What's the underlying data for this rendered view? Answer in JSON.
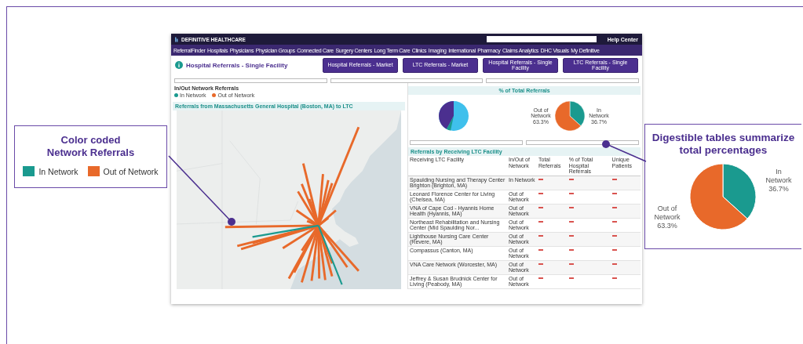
{
  "left_callout": {
    "title": "Color coded Network Referrals",
    "legend": [
      {
        "label": "In Network",
        "color": "#1a9a8f"
      },
      {
        "label": "Out of Network",
        "color": "#e8692a"
      }
    ]
  },
  "dashboard": {
    "logo": "DEFINITIVE HEALTHCARE",
    "help_link": "Help Center",
    "nav": [
      "ReferralFinder",
      "Hospitals",
      "Physicians",
      "Physician Groups",
      "Connected Care",
      "Surgery Centers",
      "Long Term Care",
      "Clinics",
      "Imaging",
      "International",
      "Pharmacy",
      "Claims Analytics",
      "DHC Visuals",
      "My Definitive"
    ],
    "page_title": "Hospital Referrals - Single Facility",
    "buttons": [
      "Hospital Referrals - Market",
      "LTC Referrals - Market",
      "Hospital Referrals - Single Facility",
      "LTC Referrals - Single Facility"
    ],
    "legend": {
      "title": "In/Out Network Referrals",
      "items": [
        {
          "label": "In Network",
          "color": "#1a9a8f"
        },
        {
          "label": "Out of Network",
          "color": "#e8692a"
        }
      ]
    },
    "map": {
      "title": "Referrals from Massachusetts General Hospital (Boston, MA) to LTC"
    },
    "pies": {
      "title": "% of Total Referrals",
      "chart_data": {
        "type": "pie",
        "categories": [
          "In Network",
          "Out of Network"
        ],
        "values": [
          36.7,
          63.3
        ],
        "value_labels": [
          "36.7%",
          "63.3%"
        ]
      }
    },
    "table": {
      "title": "Referrals by Receiving LTC Facility",
      "columns": [
        "Receiving LTC Facility",
        "In/Out of Network",
        "Total Referrals",
        "% of Total Hospital Referrals",
        "Unique Patients"
      ],
      "rows": [
        {
          "facility": "Spaulding Nursing and Therapy Center Brighton (Brighton, MA)",
          "network": "In Network"
        },
        {
          "facility": "Leonard Florence Center for Living (Chelsea, MA)",
          "network": "Out of Network"
        },
        {
          "facility": "VNA of Cape Cod - Hyannis Home Health (Hyannis, MA)",
          "network": "Out of Network"
        },
        {
          "facility": "Northeast Rehabilitation and Nursing Center (Mid Spaulding Nor...",
          "network": "Out of Network"
        },
        {
          "facility": "Lighthouse Nursing Care Center (Revere, MA)",
          "network": "Out of Network"
        },
        {
          "facility": "Compassus (Canton, MA)",
          "network": "Out of Network"
        },
        {
          "facility": "VNA Care Network (Worcester, MA)",
          "network": "Out of Network"
        },
        {
          "facility": "Jeffrey & Susan Brudnick Center for Living (Peabody, MA)",
          "network": "Out of Network"
        }
      ]
    }
  },
  "right_callout": {
    "title": "Digestible tables summarize total percentages",
    "chart_data": {
      "type": "pie",
      "categories": [
        "In Network",
        "Out of Network"
      ],
      "values": [
        36.7,
        63.3
      ],
      "value_labels": [
        "36.7%",
        "63.3%"
      ]
    }
  }
}
